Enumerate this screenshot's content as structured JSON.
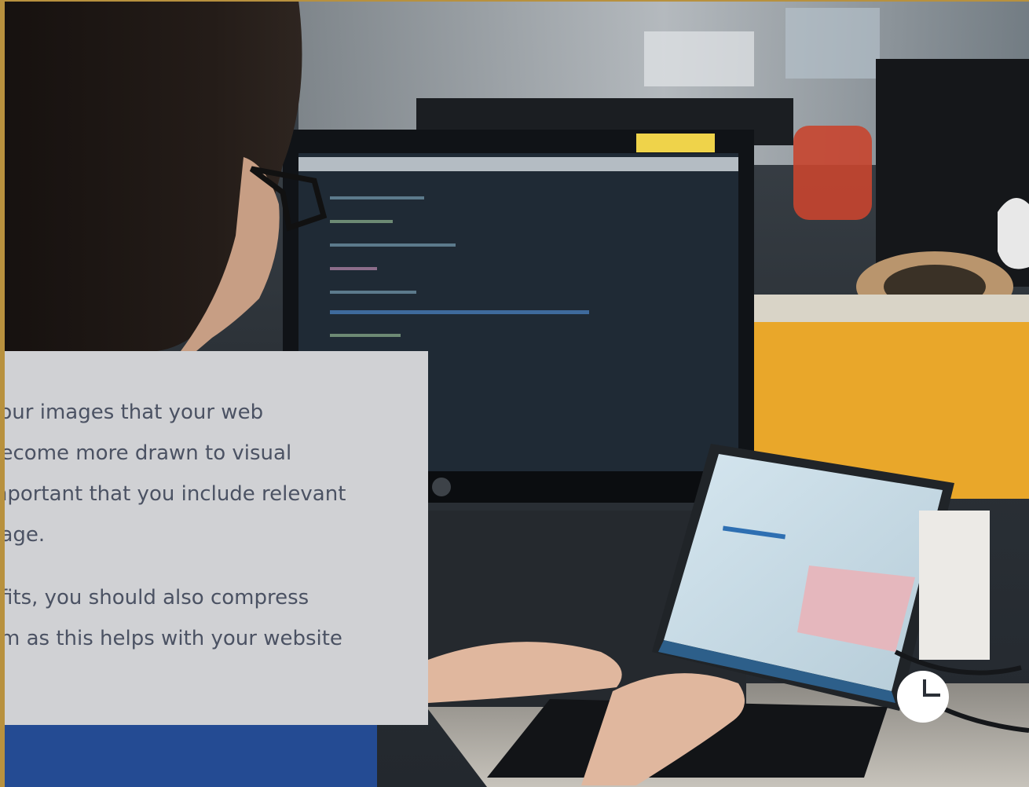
{
  "article": {
    "paragraph_1": [
      "your images that your web",
      "become more drawn to visual",
      "mportant that you include relevant",
      "nage."
    ],
    "paragraph_2": [
      "efits, you should also compress",
      "em as this helps with your website"
    ]
  },
  "widget": {
    "icon": "pie-chart-icon"
  },
  "colors": {
    "accent_border": "#b8913e",
    "card_background": "#d0d1d4",
    "body_text": "#4b5263"
  }
}
